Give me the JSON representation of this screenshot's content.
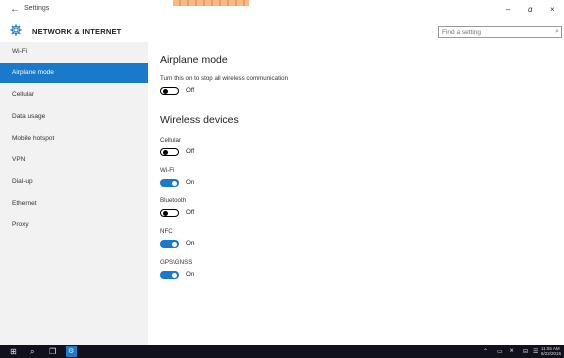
{
  "window": {
    "app_title": "Settings",
    "back_glyph": "←",
    "minimize_glyph": "–",
    "maximize_glyph": "ɑ",
    "close_glyph": "×"
  },
  "header": {
    "section_title": "NETWORK & INTERNET",
    "search_placeholder": "Find a setting",
    "search_glyph": "⌕"
  },
  "sidebar": {
    "items": [
      {
        "label": "Wi-Fi"
      },
      {
        "label": "Airplane mode"
      },
      {
        "label": "Cellular"
      },
      {
        "label": "Data usage"
      },
      {
        "label": "Mobile hotspot"
      },
      {
        "label": "VPN"
      },
      {
        "label": "Dial-up"
      },
      {
        "label": "Ethernet"
      },
      {
        "label": "Proxy"
      }
    ],
    "active_item": "Airplane mode"
  },
  "main": {
    "airplane": {
      "heading": "Airplane mode",
      "description": "Turn this on to stop all wireless communication",
      "state": "Off"
    },
    "wireless": {
      "heading": "Wireless devices",
      "devices": [
        {
          "label": "Cellular",
          "state": "Off"
        },
        {
          "label": "Wi-Fi",
          "state": "On"
        },
        {
          "label": "Bluetooth",
          "state": "Off"
        },
        {
          "label": "NFC",
          "state": "On"
        },
        {
          "label": "GPS\\GNSS",
          "state": "On"
        }
      ]
    }
  },
  "taskbar": {
    "start_glyph": "⊞",
    "search_glyph": "⌕",
    "taskview_glyph": "❐",
    "settings_glyph": "⚙",
    "tray": {
      "chevron": "⌃",
      "battery": "▭",
      "network": "⩙",
      "volume": "⊟",
      "message": "☰"
    },
    "clock_time": "11:55 AM",
    "clock_date": "6/22/2015"
  },
  "colors": {
    "accent": "#1979ca",
    "sidebar_bg": "#f2f2f2",
    "taskbar_bg": "#10111a"
  }
}
